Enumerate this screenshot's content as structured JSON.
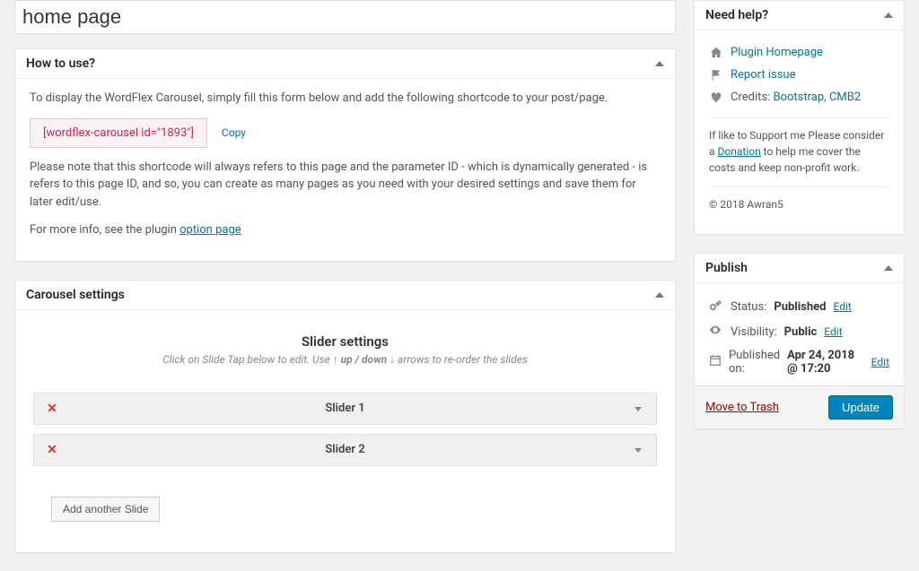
{
  "title_value": "home page",
  "how_to": {
    "heading": "How to use?",
    "intro": "To display the WordFlex Carousel, simply fill this form below and add the following shortcode to your post/page.",
    "shortcode": "[wordflex-carousel id=\"1893\"]",
    "copy_label": "Copy",
    "note": "Please note that this shortcode will always refers to this page and the parameter ID - which is dynamically generated - is refers to this page ID, and so, you can create as many pages as you need with your desired settings and save them for later edit/use.",
    "more_info_pre": "For more info, see the plugin ",
    "more_info_link": "option page"
  },
  "carousel": {
    "heading": "Carousel settings",
    "slider_heading": "Slider settings",
    "slider_sub_pre": "Click on Slide Tap below to edit. Use ↑ ",
    "slider_sub_mid": "up / down",
    "slider_sub_post": " ↓ arrows to re-order the slides",
    "slides": [
      "Slider 1",
      "Slider 2"
    ],
    "add_label": "Add another Slide"
  },
  "help": {
    "heading": "Need help?",
    "items": [
      {
        "icon": "home",
        "label": "Plugin Homepage"
      },
      {
        "icon": "flag",
        "label": "Report issue"
      }
    ],
    "credits_label": "Credits:",
    "credits_links": [
      "Bootstrap",
      "CMB2"
    ],
    "support_pre": "If like to Support me Please consider a ",
    "support_link": "Donation",
    "support_post": " to help me cover the costs and keep non-profit work.",
    "copyright": "© 2018 Awran5"
  },
  "publish": {
    "heading": "Publish",
    "status_label": "Status:",
    "status_value": "Published",
    "visibility_label": "Visibility:",
    "visibility_value": "Public",
    "published_label": "Published on:",
    "published_value": "Apr 24, 2018 @ 17:20",
    "edit_label": "Edit",
    "trash_label": "Move to Trash",
    "update_label": "Update"
  }
}
